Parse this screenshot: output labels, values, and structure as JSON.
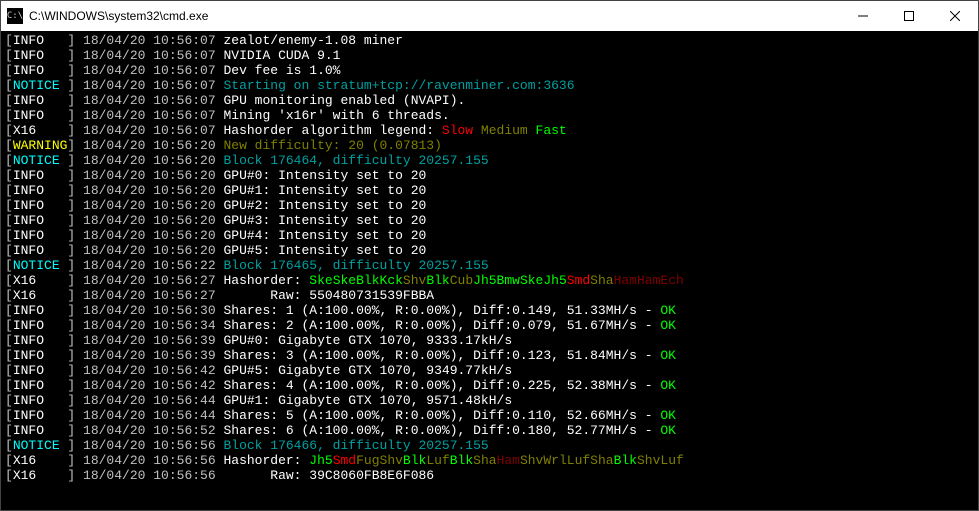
{
  "window": {
    "title": "C:\\WINDOWS\\system32\\cmd.exe",
    "icon_label": "cmd-icon"
  },
  "colors": {
    "slow": "#ff0000",
    "medium": "#808000",
    "fast": "#00ff00",
    "ok": "#00ff00",
    "notice": "#00ffff",
    "warning": "#ffff00"
  },
  "log": [
    {
      "level": "INFO",
      "ts": "18/04/20 10:56:07",
      "segs": [
        {
          "t": "zealot/enemy-1.08 miner",
          "c": "wh"
        }
      ]
    },
    {
      "level": "INFO",
      "ts": "18/04/20 10:56:07",
      "segs": [
        {
          "t": "NVIDIA CUDA 9.1",
          "c": "wh"
        }
      ]
    },
    {
      "level": "INFO",
      "ts": "18/04/20 10:56:07",
      "segs": [
        {
          "t": "Dev fee is 1.0%",
          "c": "wh"
        }
      ]
    },
    {
      "level": "NOTICE",
      "ts": "18/04/20 10:56:07",
      "segs": [
        {
          "t": "Starting on stratum+tcp://ravenminer.com:3636",
          "c": "cy"
        }
      ]
    },
    {
      "level": "INFO",
      "ts": "18/04/20 10:56:07",
      "segs": [
        {
          "t": "GPU monitoring enabled (NVAPI).",
          "c": "wh"
        }
      ]
    },
    {
      "level": "INFO",
      "ts": "18/04/20 10:56:07",
      "segs": [
        {
          "t": "Mining 'x16r' with 6 threads.",
          "c": "wh"
        }
      ]
    },
    {
      "level": "X16",
      "ts": "18/04/20 10:56:07",
      "segs": [
        {
          "t": "Hashorder algorithm legend: ",
          "c": "wh"
        },
        {
          "t": "Slow ",
          "c": "rd"
        },
        {
          "t": "Medium ",
          "c": "dy"
        },
        {
          "t": "Fast",
          "c": "gr"
        }
      ]
    },
    {
      "level": "WARNING",
      "ts": "18/04/20 10:56:20",
      "segs": [
        {
          "t": "New difficulty: 20 (0.07813)",
          "c": "dy"
        }
      ]
    },
    {
      "level": "NOTICE",
      "ts": "18/04/20 10:56:20",
      "segs": [
        {
          "t": "Block 176464, difficulty 20257.155",
          "c": "cy"
        }
      ]
    },
    {
      "level": "INFO",
      "ts": "18/04/20 10:56:20",
      "segs": [
        {
          "t": "GPU#0: Intensity set to 20",
          "c": "wh"
        }
      ]
    },
    {
      "level": "INFO",
      "ts": "18/04/20 10:56:20",
      "segs": [
        {
          "t": "GPU#1: Intensity set to 20",
          "c": "wh"
        }
      ]
    },
    {
      "level": "INFO",
      "ts": "18/04/20 10:56:20",
      "segs": [
        {
          "t": "GPU#2: Intensity set to 20",
          "c": "wh"
        }
      ]
    },
    {
      "level": "INFO",
      "ts": "18/04/20 10:56:20",
      "segs": [
        {
          "t": "GPU#3: Intensity set to 20",
          "c": "wh"
        }
      ]
    },
    {
      "level": "INFO",
      "ts": "18/04/20 10:56:20",
      "segs": [
        {
          "t": "GPU#4: Intensity set to 20",
          "c": "wh"
        }
      ]
    },
    {
      "level": "INFO",
      "ts": "18/04/20 10:56:20",
      "segs": [
        {
          "t": "GPU#5: Intensity set to 20",
          "c": "wh"
        }
      ]
    },
    {
      "level": "NOTICE",
      "ts": "18/04/20 10:56:22",
      "segs": [
        {
          "t": "Block 176465, difficulty 20257.155",
          "c": "cy"
        }
      ]
    },
    {
      "level": "X16",
      "ts": "18/04/20 10:56:27",
      "segs": [
        {
          "t": "Hashorder: ",
          "c": "wh"
        },
        {
          "t": "Ske",
          "c": "gr"
        },
        {
          "t": "Ske",
          "c": "gr"
        },
        {
          "t": "Blk",
          "c": "gr"
        },
        {
          "t": "Kck",
          "c": "gr"
        },
        {
          "t": "Shv",
          "c": "dy"
        },
        {
          "t": "Blk",
          "c": "gr"
        },
        {
          "t": "Cub",
          "c": "dy"
        },
        {
          "t": "Jh5",
          "c": "gr"
        },
        {
          "t": "Bmw",
          "c": "gr"
        },
        {
          "t": "Ske",
          "c": "gr"
        },
        {
          "t": "Jh5",
          "c": "gr"
        },
        {
          "t": "Smd",
          "c": "rd"
        },
        {
          "t": "Sha",
          "c": "dy"
        },
        {
          "t": "Ham",
          "c": "dr"
        },
        {
          "t": "Ham",
          "c": "dr"
        },
        {
          "t": "Ech",
          "c": "dr"
        }
      ]
    },
    {
      "level": "X16",
      "ts": "18/04/20 10:56:27",
      "segs": [
        {
          "t": "      Raw: 550480731539FBBA",
          "c": "wh"
        }
      ]
    },
    {
      "level": "INFO",
      "ts": "18/04/20 10:56:30",
      "segs": [
        {
          "t": "Shares: 1 (A:100.00%, R:0.00%), Diff:0.149, 51.33MH/s - ",
          "c": "wh"
        },
        {
          "t": "OK",
          "c": "gr"
        }
      ]
    },
    {
      "level": "INFO",
      "ts": "18/04/20 10:56:34",
      "segs": [
        {
          "t": "Shares: 2 (A:100.00%, R:0.00%), Diff:0.079, 51.67MH/s - ",
          "c": "wh"
        },
        {
          "t": "OK",
          "c": "gr"
        }
      ]
    },
    {
      "level": "INFO",
      "ts": "18/04/20 10:56:39",
      "segs": [
        {
          "t": "GPU#0: Gigabyte GTX 1070, 9333.17kH/s",
          "c": "wh"
        }
      ]
    },
    {
      "level": "INFO",
      "ts": "18/04/20 10:56:39",
      "segs": [
        {
          "t": "Shares: 3 (A:100.00%, R:0.00%), Diff:0.123, 51.84MH/s - ",
          "c": "wh"
        },
        {
          "t": "OK",
          "c": "gr"
        }
      ]
    },
    {
      "level": "INFO",
      "ts": "18/04/20 10:56:42",
      "segs": [
        {
          "t": "GPU#5: Gigabyte GTX 1070, 9349.77kH/s",
          "c": "wh"
        }
      ]
    },
    {
      "level": "INFO",
      "ts": "18/04/20 10:56:42",
      "segs": [
        {
          "t": "Shares: 4 (A:100.00%, R:0.00%), Diff:0.225, 52.38MH/s - ",
          "c": "wh"
        },
        {
          "t": "OK",
          "c": "gr"
        }
      ]
    },
    {
      "level": "INFO",
      "ts": "18/04/20 10:56:44",
      "segs": [
        {
          "t": "GPU#1: Gigabyte GTX 1070, 9571.48kH/s",
          "c": "wh"
        }
      ]
    },
    {
      "level": "INFO",
      "ts": "18/04/20 10:56:44",
      "segs": [
        {
          "t": "Shares: 5 (A:100.00%, R:0.00%), Diff:0.110, 52.66MH/s - ",
          "c": "wh"
        },
        {
          "t": "OK",
          "c": "gr"
        }
      ]
    },
    {
      "level": "INFO",
      "ts": "18/04/20 10:56:52",
      "segs": [
        {
          "t": "Shares: 6 (A:100.00%, R:0.00%), Diff:0.180, 52.77MH/s - ",
          "c": "wh"
        },
        {
          "t": "OK",
          "c": "gr"
        }
      ]
    },
    {
      "level": "NOTICE",
      "ts": "18/04/20 10:56:56",
      "segs": [
        {
          "t": "Block 176466, difficulty 20257.155",
          "c": "cy"
        }
      ]
    },
    {
      "level": "X16",
      "ts": "18/04/20 10:56:56",
      "segs": [
        {
          "t": "Hashorder: ",
          "c": "wh"
        },
        {
          "t": "Jh5",
          "c": "gr"
        },
        {
          "t": "Smd",
          "c": "rd"
        },
        {
          "t": "Fug",
          "c": "dy"
        },
        {
          "t": "Shv",
          "c": "dy"
        },
        {
          "t": "Blk",
          "c": "gr"
        },
        {
          "t": "Luf",
          "c": "dy"
        },
        {
          "t": "Blk",
          "c": "gr"
        },
        {
          "t": "Sha",
          "c": "dy"
        },
        {
          "t": "Ham",
          "c": "dr"
        },
        {
          "t": "Shv",
          "c": "dy"
        },
        {
          "t": "Wrl",
          "c": "dy"
        },
        {
          "t": "Luf",
          "c": "dy"
        },
        {
          "t": "Sha",
          "c": "dy"
        },
        {
          "t": "Blk",
          "c": "gr"
        },
        {
          "t": "Shv",
          "c": "dy"
        },
        {
          "t": "Luf",
          "c": "dy"
        }
      ]
    },
    {
      "level": "X16",
      "ts": "18/04/20 10:56:56",
      "segs": [
        {
          "t": "      Raw: 39C8060FB8E6F086",
          "c": "wh"
        }
      ]
    }
  ]
}
